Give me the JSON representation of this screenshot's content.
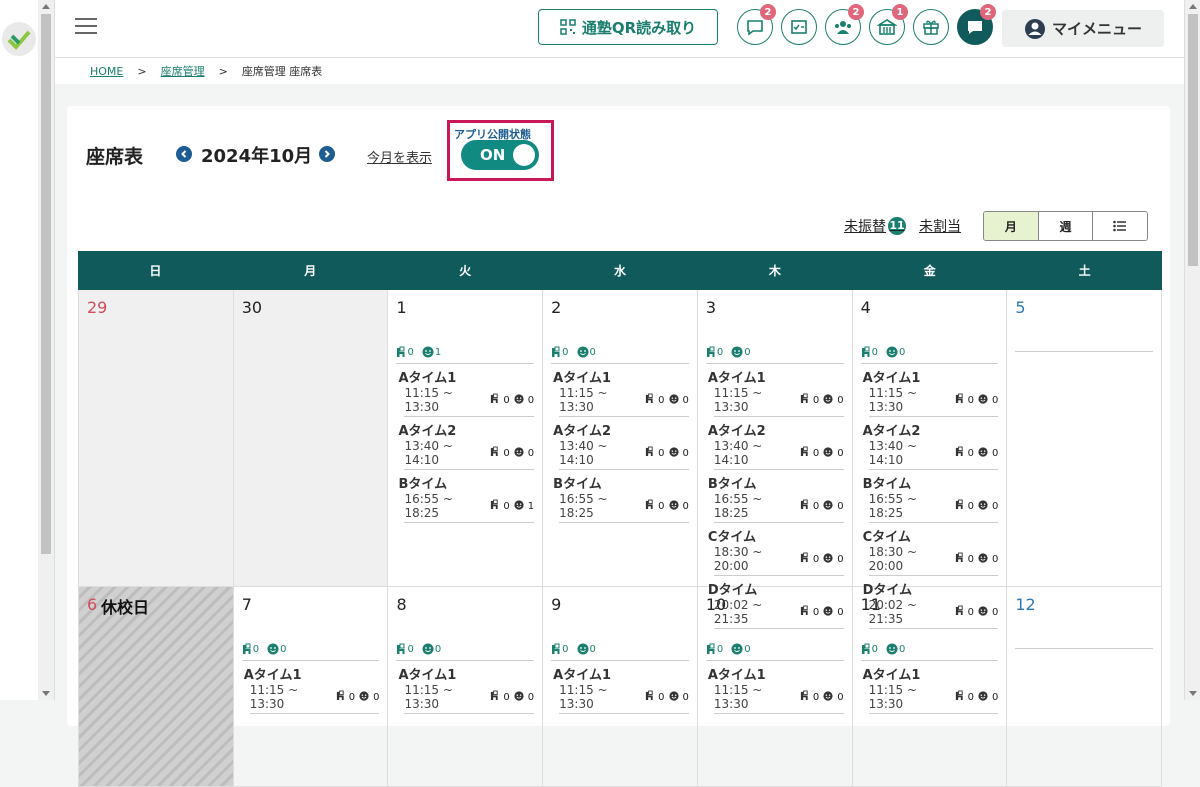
{
  "header": {
    "qr_button": "通塾QR読み取り",
    "icons": [
      {
        "name": "chat-icon",
        "badge": "2"
      },
      {
        "name": "checklist-icon",
        "badge": ""
      },
      {
        "name": "group-icon",
        "badge": "2"
      },
      {
        "name": "school-icon",
        "badge": "1"
      },
      {
        "name": "gift-icon",
        "badge": ""
      },
      {
        "name": "message-icon",
        "badge": "2"
      }
    ],
    "mymenu": "マイメニュー"
  },
  "breadcrumb": {
    "home": "HOME",
    "sep": ">",
    "seat_mgmt": "座席管理",
    "current": "座席管理 座席表"
  },
  "page": {
    "title": "座席表",
    "month": "2024年10月",
    "today_link": "今月を表示",
    "app_status_label": "アプリ公開状態",
    "app_status_value": "ON",
    "unassigned_label": "未振替",
    "unassigned_count": "11",
    "unallocated_label": "未割当",
    "view_month": "月",
    "view_week": "週"
  },
  "calendar": {
    "weekdays": [
      "日",
      "月",
      "火",
      "水",
      "木",
      "金",
      "土"
    ],
    "week1": [
      {
        "day": "29"
      },
      {
        "day": "30"
      },
      {
        "day": "1",
        "seat": "0",
        "student": "1",
        "slots": [
          {
            "name": "Aタイム1",
            "time": "11:15 ~ 13:30",
            "seat": "0",
            "student": "0"
          },
          {
            "name": "Aタイム2",
            "time": "13:40 ~ 14:10",
            "seat": "0",
            "student": "0"
          },
          {
            "name": "Bタイム",
            "time": "16:55 ~ 18:25",
            "seat": "0",
            "student": "1"
          }
        ]
      },
      {
        "day": "2",
        "seat": "0",
        "student": "0",
        "slots": [
          {
            "name": "Aタイム1",
            "time": "11:15 ~ 13:30",
            "seat": "0",
            "student": "0"
          },
          {
            "name": "Aタイム2",
            "time": "13:40 ~ 14:10",
            "seat": "0",
            "student": "0"
          },
          {
            "name": "Bタイム",
            "time": "16:55 ~ 18:25",
            "seat": "0",
            "student": "0"
          }
        ]
      },
      {
        "day": "3",
        "seat": "0",
        "student": "0",
        "slots": [
          {
            "name": "Aタイム1",
            "time": "11:15 ~ 13:30",
            "seat": "0",
            "student": "0"
          },
          {
            "name": "Aタイム2",
            "time": "13:40 ~ 14:10",
            "seat": "0",
            "student": "0"
          },
          {
            "name": "Bタイム",
            "time": "16:55 ~ 18:25",
            "seat": "0",
            "student": "0"
          },
          {
            "name": "Cタイム",
            "time": "18:30 ~ 20:00",
            "seat": "0",
            "student": "0"
          },
          {
            "name": "Dタイム",
            "time": "20:02 ~ 21:35",
            "seat": "0",
            "student": "0"
          }
        ]
      },
      {
        "day": "4",
        "seat": "0",
        "student": "0",
        "slots": [
          {
            "name": "Aタイム1",
            "time": "11:15 ~ 13:30",
            "seat": "0",
            "student": "0"
          },
          {
            "name": "Aタイム2",
            "time": "13:40 ~ 14:10",
            "seat": "0",
            "student": "0"
          },
          {
            "name": "Bタイム",
            "time": "16:55 ~ 18:25",
            "seat": "0",
            "student": "0"
          },
          {
            "name": "Cタイム",
            "time": "18:30 ~ 20:00",
            "seat": "0",
            "student": "0"
          },
          {
            "name": "Dタイム",
            "time": "20:02 ~ 21:35",
            "seat": "0",
            "student": "0"
          }
        ]
      },
      {
        "day": "5"
      }
    ],
    "week2": [
      {
        "day": "6",
        "holiday": "休校日"
      },
      {
        "day": "7",
        "seat": "0",
        "student": "0",
        "slots": [
          {
            "name": "Aタイム1",
            "time": "11:15 ~ 13:30",
            "seat": "0",
            "student": "0"
          }
        ]
      },
      {
        "day": "8",
        "seat": "0",
        "student": "0",
        "slots": [
          {
            "name": "Aタイム1",
            "time": "11:15 ~ 13:30",
            "seat": "0",
            "student": "0"
          }
        ]
      },
      {
        "day": "9",
        "seat": "0",
        "student": "0",
        "slots": [
          {
            "name": "Aタイム1",
            "time": "11:15 ~ 13:30",
            "seat": "0",
            "student": "0"
          }
        ]
      },
      {
        "day": "10",
        "seat": "0",
        "student": "0",
        "slots": [
          {
            "name": "Aタイム1",
            "time": "11:15 ~ 13:30",
            "seat": "0",
            "student": "0"
          }
        ]
      },
      {
        "day": "11",
        "seat": "0",
        "student": "0",
        "slots": [
          {
            "name": "Aタイム1",
            "time": "11:15 ~ 13:30",
            "seat": "0",
            "student": "0"
          }
        ]
      },
      {
        "day": "12"
      }
    ]
  },
  "colors": {
    "primary": "#115a5c",
    "accent": "#1a7f6e",
    "badge": "#e0667c",
    "highlight": "#c8185a"
  }
}
